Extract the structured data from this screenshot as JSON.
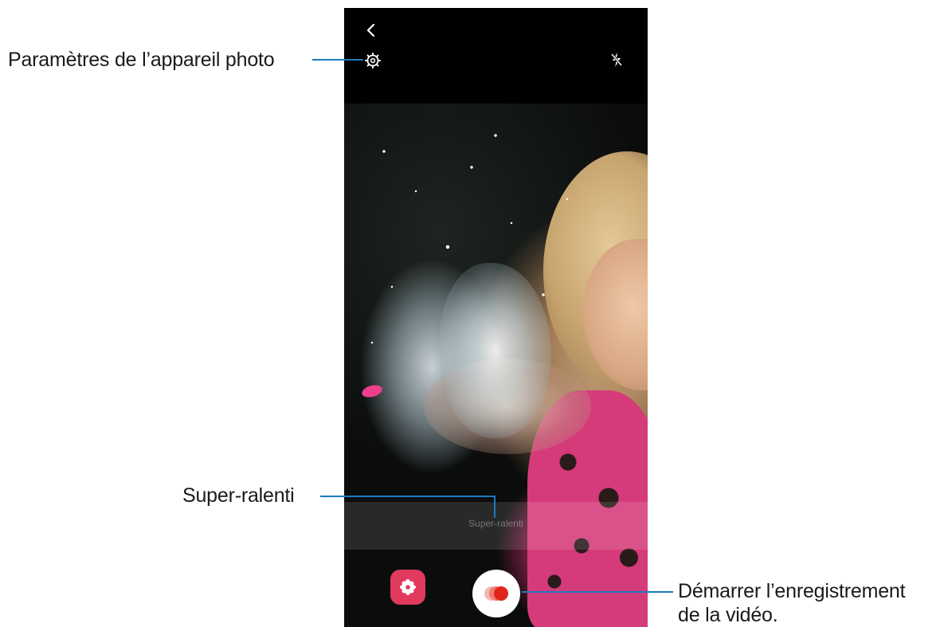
{
  "labels": {
    "settings_callout": "Paramètres de l’appareil photo",
    "mode_callout": "Super-ralenti",
    "record_callout_line1": "Démarrer l’enregistrement",
    "record_callout_line2": "de la vidéo."
  },
  "camera": {
    "mode_label": "Super-ralenti"
  },
  "icons": {
    "back": "back-chevron-icon",
    "settings": "gear-icon",
    "flash": "flash-off-icon",
    "effects": "flower-effect-icon",
    "record": "super-slow-motion-record-icon"
  },
  "colors": {
    "callout_line": "#1c7bc0",
    "effect_button": "#e03a5e",
    "record_dot": "#e1251b"
  }
}
